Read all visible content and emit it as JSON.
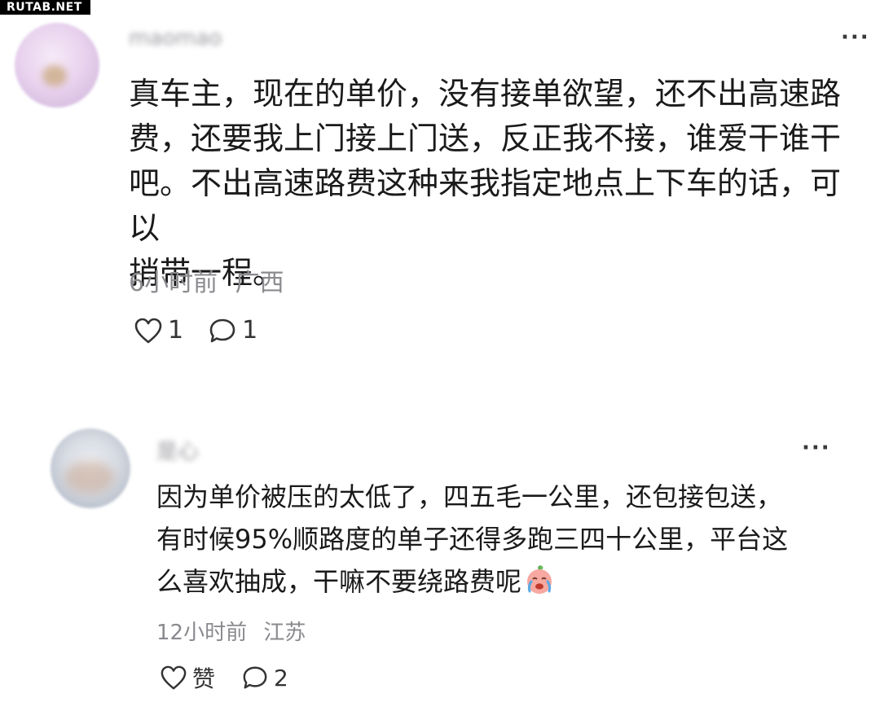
{
  "watermark": "RUTAB.NET",
  "comments": [
    {
      "username": "maomao",
      "text": "真车主，现在的单价，没有接单欲望，还不出高速路\n费，还要我上门接上门送，反正我不接，谁爱干谁干\n吧。不出高速路费这种来我指定地点上下车的话，可以\n捎带一程。",
      "time": "6小时前",
      "location": "广西",
      "likes": "1",
      "replies": "1"
    },
    {
      "username": "是心",
      "text": "因为单价被压的太低了，四五毛一公里，还包接包送，\n有时候95%顺路度的单子还得多跑三四十公里，平台这\n么喜欢抽成，干嘛不要绕路费呢",
      "emoji": "crying-face",
      "time": "12小时前",
      "location": "江苏",
      "likes": "赞",
      "replies": "2"
    }
  ],
  "icons": {
    "more": "more-icon",
    "like": "heart-icon",
    "reply": "comment-icon"
  },
  "colors": {
    "text": "#1a1a1a",
    "meta": "#8a8a8f",
    "icon": "#333333"
  }
}
